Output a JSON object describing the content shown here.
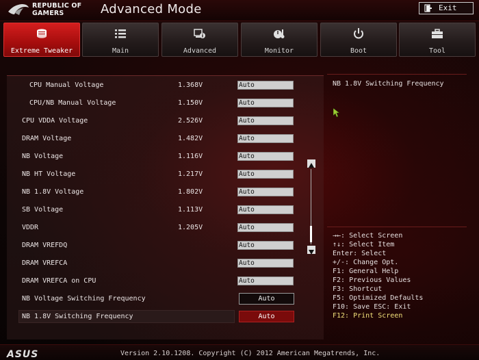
{
  "header": {
    "brand_line1": "REPUBLIC OF",
    "brand_line2": "GAMERS",
    "title": "Advanced Mode",
    "exit_label": "Exit",
    "exit_icon": "door-exit-icon"
  },
  "tabs": [
    {
      "label": "Extreme Tweaker",
      "icon": "tweaker-icon",
      "active": true
    },
    {
      "label": "Main",
      "icon": "list-icon",
      "active": false
    },
    {
      "label": "Advanced",
      "icon": "advanced-settings-icon",
      "active": false
    },
    {
      "label": "Monitor",
      "icon": "monitor-gauge-icon",
      "active": false
    },
    {
      "label": "Boot",
      "icon": "power-icon",
      "active": false
    },
    {
      "label": "Tool",
      "icon": "toolbox-icon",
      "active": false
    }
  ],
  "settings": [
    {
      "label": "CPU Manual Voltage",
      "value": "1.368V",
      "field": "Auto"
    },
    {
      "label": "CPU/NB Manual Voltage",
      "value": "1.150V",
      "field": "Auto"
    },
    {
      "label": "CPU VDDA Voltage",
      "value": "2.526V",
      "field": "Auto"
    },
    {
      "label": "DRAM Voltage",
      "value": "1.482V",
      "field": "Auto"
    },
    {
      "label": "NB Voltage",
      "value": "1.116V",
      "field": "Auto"
    },
    {
      "label": "NB HT Voltage",
      "value": "1.217V",
      "field": "Auto"
    },
    {
      "label": "NB 1.8V Voltage",
      "value": "1.802V",
      "field": "Auto"
    },
    {
      "label": "SB Voltage",
      "value": "1.113V",
      "field": "Auto"
    },
    {
      "label": "VDDR",
      "value": "1.205V",
      "field": "Auto"
    },
    {
      "label": "DRAM VREFDQ",
      "value": "",
      "field": "Auto"
    },
    {
      "label": "DRAM VREFCA",
      "value": "",
      "field": "Auto"
    },
    {
      "label": "DRAM VREFCA on CPU",
      "value": "",
      "field": "Auto"
    },
    {
      "label": "NB Voltage Switching Frequency",
      "value": "",
      "button": "Auto"
    },
    {
      "label": "NB 1.8V Switching Frequency",
      "value": "",
      "button": "Auto",
      "selected": true
    }
  ],
  "help": {
    "title": "NB 1.8V Switching Frequency",
    "keys": [
      "→←: Select Screen",
      "↑↓: Select Item",
      "Enter: Select",
      "+/-: Change Opt.",
      "F1: General Help",
      "F2: Previous Values",
      "F3: Shortcut",
      "F5: Optimized Defaults",
      "F10: Save  ESC: Exit",
      "F12: Print Screen"
    ]
  },
  "footer": {
    "logo": "ASUS",
    "version": "Version 2.10.1208. Copyright (C) 2012 American Megatrends, Inc."
  },
  "colors": {
    "accent_red": "#c41414",
    "highlight_yellow": "#f2e07a"
  }
}
